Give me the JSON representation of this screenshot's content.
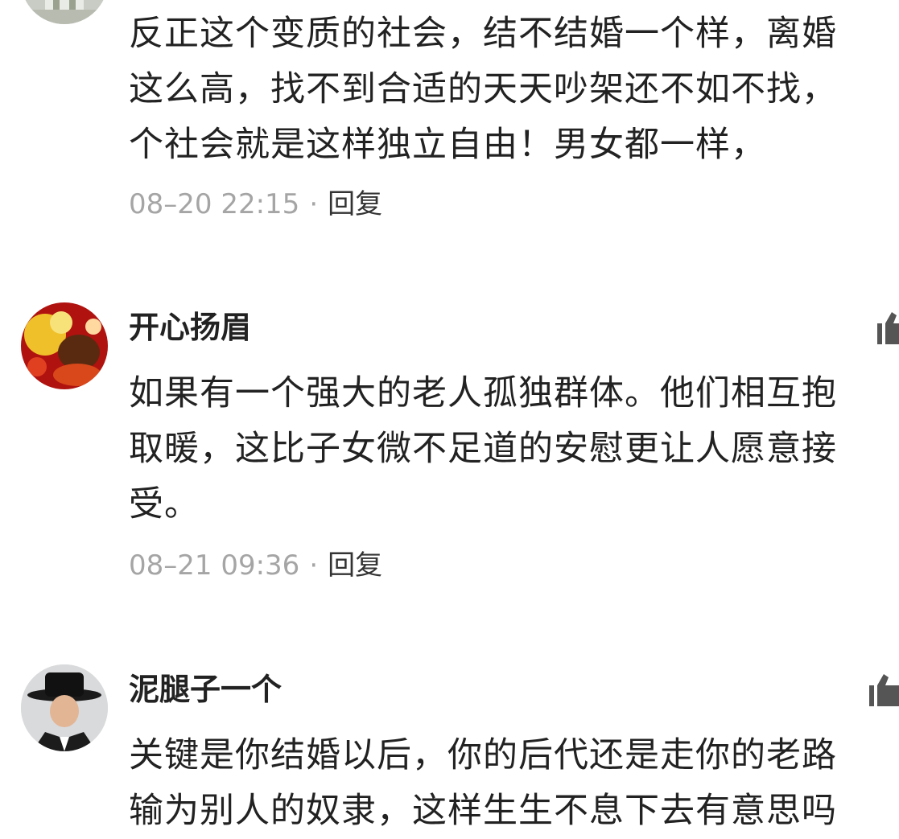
{
  "comments": [
    {
      "username": "",
      "text_lines": [
        "反正这个变质的社会，结不结婚一个样，离婚",
        "这么高，找不到合适的天天吵架还不如不找，",
        "个社会就是这样独立自由！男女都一样，"
      ],
      "time": "08–20 22:15",
      "dot": "·",
      "reply_label": "回复",
      "avatar_icon": "avatar-image",
      "like_icon": "thumbs-up-icon"
    },
    {
      "username": "开心扬眉",
      "text_lines": [
        "如果有一个强大的老人孤独群体。他们相互抱",
        "取暖，这比子女微不足道的安慰更让人愿意接",
        "受。"
      ],
      "time": "08–21 09:36",
      "dot": "·",
      "reply_label": "回复",
      "avatar_icon": "avatar-image",
      "like_icon": "thumbs-up-icon"
    },
    {
      "username": "泥腿子一个",
      "text_lines": [
        "关键是你结婚以后，你的后代还是走你的老路",
        "输为别人的奴隶，这样生生不息下去有意思吗"
      ],
      "time": "",
      "dot": "",
      "reply_label": "",
      "avatar_icon": "avatar-image",
      "like_icon": "thumbs-up-icon"
    }
  ],
  "colors": {
    "text": "#222222",
    "meta": "#a5a5a5",
    "reply": "#333333",
    "background": "#ffffff"
  }
}
